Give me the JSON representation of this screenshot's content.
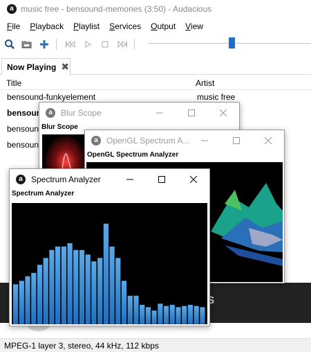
{
  "app": {
    "title": "music free - bensound-memories (3:50) - Audacious"
  },
  "menu": {
    "items": [
      "File",
      "Playback",
      "Playlist",
      "Services",
      "Output",
      "View"
    ]
  },
  "toolbar": {
    "icons": [
      "search-icon",
      "folder-open-icon",
      "add-icon",
      "previous-icon",
      "play-icon",
      "stop-icon",
      "next-icon"
    ],
    "seek_position": 0.5
  },
  "tab": {
    "label": "Now Playing",
    "close_glyph": "✖"
  },
  "playlist": {
    "columns": {
      "title": "Title",
      "artist": "Artist"
    },
    "rows": [
      {
        "title": "bensound-funkyelement",
        "artist": "music free",
        "playing": false
      },
      {
        "title": "bensoun",
        "artist": "",
        "playing": true
      },
      {
        "title": "bensoun",
        "artist": "",
        "playing": false
      },
      {
        "title": "bensoun",
        "artist": "",
        "playing": false
      }
    ]
  },
  "windows": {
    "blur_scope": {
      "title": "Blur Scope",
      "label": "Blur Scope"
    },
    "opengl": {
      "title": "OpenGL Spectrum A...",
      "label": "OpenGL Spectrum Analyzer"
    },
    "spectrum": {
      "title": "Spectrum Analyzer",
      "label": "Spectrum Analyzer"
    }
  },
  "spectrum_levels": [
    0.35,
    0.38,
    0.42,
    0.45,
    0.52,
    0.58,
    0.65,
    0.68,
    0.68,
    0.71,
    0.65,
    0.65,
    0.61,
    0.55,
    0.58,
    0.88,
    0.68,
    0.58,
    0.38,
    0.25,
    0.25,
    0.17,
    0.15,
    0.12,
    0.18,
    0.16,
    0.17,
    0.15,
    0.16,
    0.17,
    0.16,
    0.15
  ],
  "colors": {
    "accent": "#1f70c9",
    "bar_top": "#5aa9e8",
    "bar_bottom": "#1e6fc0"
  },
  "status": {
    "text": "MPEG-1 layer 3, stereo, 44 kHz, 112 kbps"
  }
}
